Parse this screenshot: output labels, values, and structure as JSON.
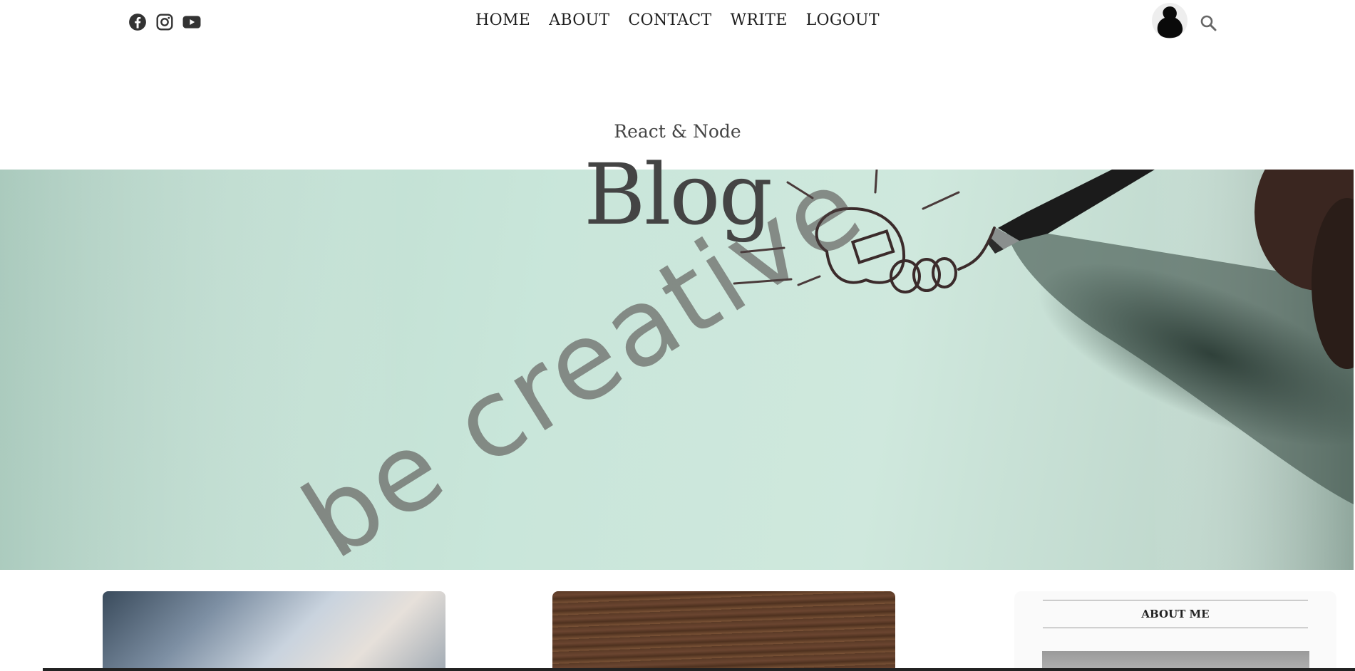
{
  "nav": {
    "items": [
      "HOME",
      "ABOUT",
      "CONTACT",
      "WRITE",
      "LOGOUT"
    ]
  },
  "social": {
    "icons": [
      "facebook-icon",
      "instagram-icon",
      "youtube-icon"
    ]
  },
  "header": {
    "subtitle": "React & Node",
    "title": "Blog"
  },
  "hero": {
    "image_text": "be creative"
  },
  "sidebar": {
    "title": "ABOUT ME"
  },
  "colors": {
    "text": "#1f1f1f",
    "title": "#444444",
    "hero_bg": "#c9e6da"
  }
}
